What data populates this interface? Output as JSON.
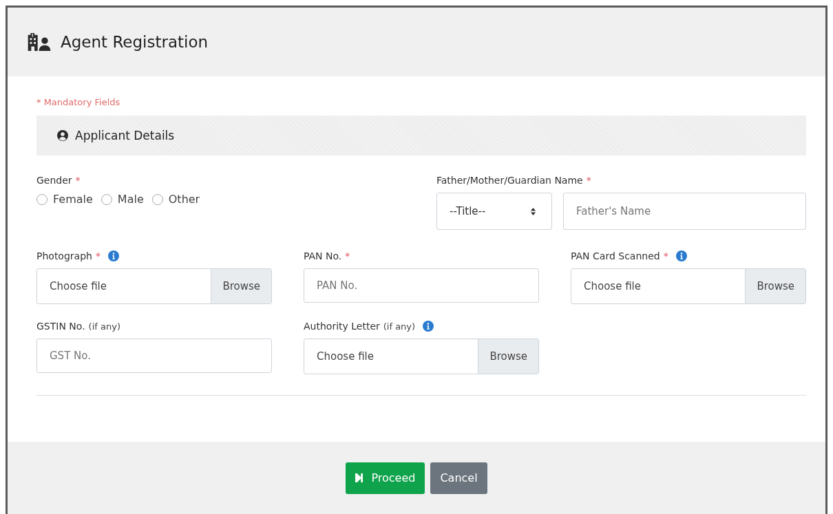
{
  "dialog": {
    "title": "Agent Registration"
  },
  "mandatory_note": "* Mandatory Fields",
  "section": {
    "title": "Applicant Details"
  },
  "row_1": [
    {
      "kind": "radio",
      "label": "Gender",
      "asterisk": "*",
      "options": [
        {
          "label": "Female",
          "selected": false
        },
        {
          "label": "Male",
          "selected": false
        },
        {
          "label": "Other",
          "selected": false
        }
      ]
    },
    {
      "kind": "name",
      "label": "Father/Mother/Guardian Name",
      "asterisk": "*",
      "select_value": "--Title--",
      "placeholder": "Father's Name"
    }
  ],
  "row_2": [
    {
      "kind": "file",
      "label": "Photograph",
      "asterisk": "*",
      "info": true,
      "value": "Choose file",
      "button": "Browse"
    },
    {
      "kind": "text",
      "label": "PAN No.",
      "asterisk": "*",
      "info": false,
      "placeholder": "PAN No."
    },
    {
      "kind": "file",
      "label": "PAN Card Scanned",
      "asterisk": "*",
      "info": true,
      "value": "Choose file",
      "button": "Browse"
    },
    {
      "kind": "text",
      "label": "GSTIN No.",
      "note": "(if any)",
      "info": false,
      "placeholder": "GST No."
    },
    {
      "kind": "file",
      "label": "Authority Letter",
      "note": "(if any)",
      "info": true,
      "value": "Choose file",
      "button": "Browse"
    }
  ],
  "buttons": [
    {
      "kind": "primary",
      "label": "Proceed"
    },
    {
      "kind": "secondary",
      "label": "Cancel"
    }
  ]
}
